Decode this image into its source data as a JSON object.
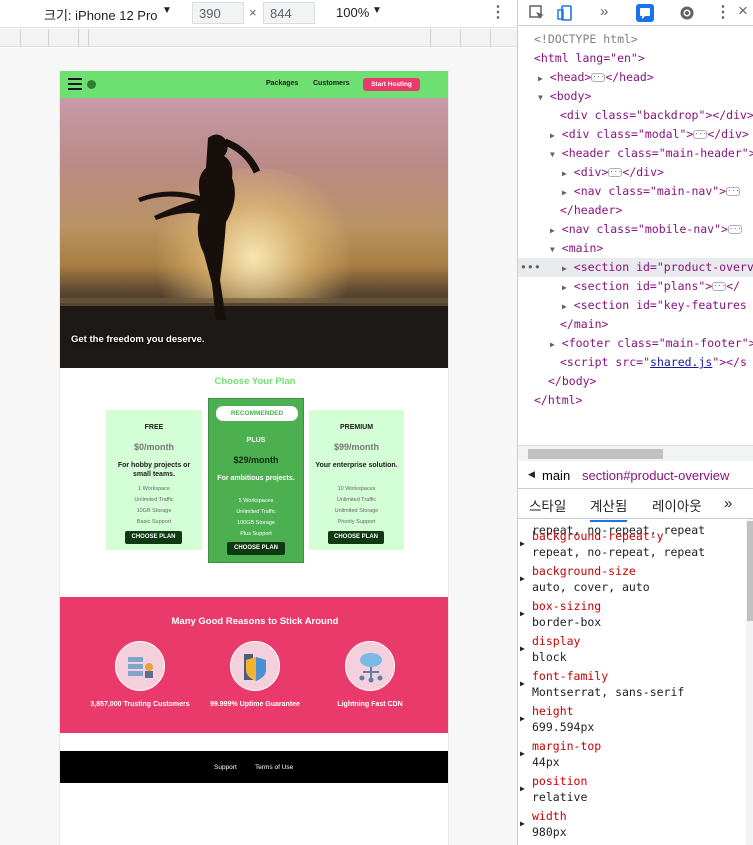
{
  "device_toolbar": {
    "device_label": "크기: iPhone 12 Pro",
    "width": "390",
    "height": "844",
    "times": "×",
    "zoom": "100%"
  },
  "site": {
    "nav": {
      "packages": "Packages",
      "customers": "Customers",
      "cta": "Start Hosting"
    },
    "hero_tagline": "Get the freedom you deserve.",
    "plans_title": "Choose Your Plan",
    "plans": [
      {
        "name": "FREE",
        "price": "$0/month",
        "desc": "For hobby projects or small teams.",
        "features": [
          "1 Workspace",
          "Unlimited Traffic",
          "10GB Storage",
          "Basic Support"
        ],
        "button": "CHOOSE PLAN"
      },
      {
        "badge": "RECOMMENDED",
        "name": "PLUS",
        "price": "$29/month",
        "desc": "For ambitious projects.",
        "features": [
          "5 Workspaces",
          "Unlimited Traffic",
          "100GB Storage",
          "Plus Support"
        ],
        "button": "CHOOSE PLAN"
      },
      {
        "name": "PREMIUM",
        "price": "$99/month",
        "desc": "Your enterprise solution.",
        "features": [
          "10 Workspaces",
          "Unlimited Traffic",
          "Unlimited Storage",
          "Priority Support"
        ],
        "button": "CHOOSE PLAN"
      }
    ],
    "features_title": "Many Good Reasons to Stick Around",
    "features": [
      {
        "label": "3,857,000 Trusting Customers",
        "icon": "customers-icon"
      },
      {
        "label": "99.999% Uptime Guarantee",
        "icon": "uptime-shield-icon"
      },
      {
        "label": "Lightning Fast CDN",
        "icon": "cdn-cloud-icon"
      }
    ],
    "footer": {
      "support": "Support",
      "terms": "Terms of Use"
    }
  },
  "devtools": {
    "dom": {
      "doctype": "<!DOCTYPE html>",
      "html_open": "<html lang=\"en\">",
      "head": "<head>",
      "head_close": "</head>",
      "body": "<body>",
      "backdrop": "<div class=\"backdrop\"></div>",
      "modal": "<div class=\"modal\">",
      "modal_close": "</div>",
      "header": "<header class=\"main-header\">",
      "div": "<div>",
      "div_close": "</div>",
      "main_nav": "<nav class=\"main-nav\">",
      "header_close": "</header>",
      "mobile_nav": "<nav class=\"mobile-nav\">",
      "main": "<main>",
      "section_overview": "<section id=\"product-overv",
      "section_plans": "<section id=\"plans\">",
      "section_plans_close": "</",
      "section_features": "<section id=\"key-features",
      "main_close": "</main>",
      "footer": "<footer class=\"main-footer\">",
      "script_pre": "<script src=\"",
      "script_src": "shared.js",
      "script_post": "\"></s",
      "body_close": "</body>",
      "html_close": "</html>",
      "ellipsis": "•••"
    },
    "breadcrumbs": [
      "main",
      "section#product-overview"
    ],
    "subtabs": {
      "styles": "스타일",
      "computed": "계산됨",
      "layout": "레이아웃",
      "more": "»"
    },
    "properties": [
      {
        "name": "",
        "value": "repeat, no-repeat, repeat"
      },
      {
        "name": "background-repeat-y",
        "value": "repeat, no-repeat, repeat"
      },
      {
        "name": "background-size",
        "value": "auto, cover, auto"
      },
      {
        "name": "box-sizing",
        "value": "border-box"
      },
      {
        "name": "display",
        "value": "block"
      },
      {
        "name": "font-family",
        "value": "Montserrat, sans-serif"
      },
      {
        "name": "height",
        "value": "699.594px"
      },
      {
        "name": "margin-top",
        "value": "44px"
      },
      {
        "name": "position",
        "value": "relative"
      },
      {
        "name": "width",
        "value": "980px"
      }
    ]
  },
  "colors": {
    "header_green": "#6ee071",
    "plan_light": "#d4ffd6",
    "plan_rec": "#4caf50",
    "pink": "#ea3a6b",
    "devtools_blue": "#1a73e8"
  }
}
